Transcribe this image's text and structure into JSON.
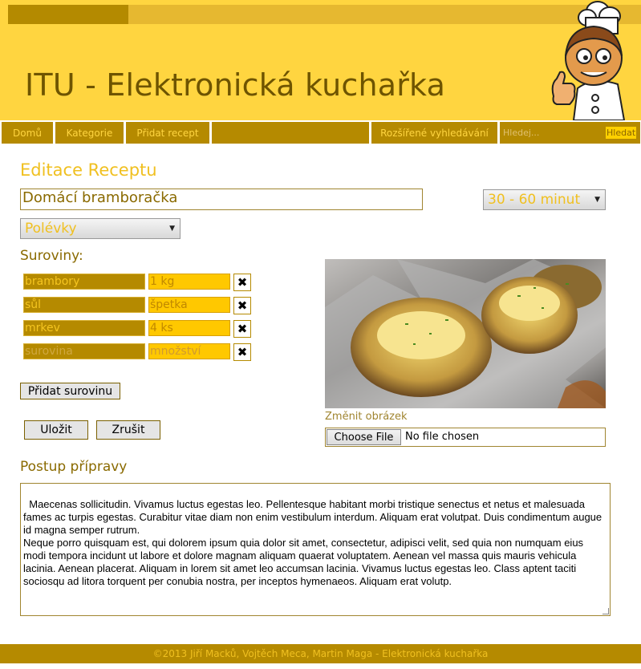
{
  "header": {
    "title": "ITU - Elektronická kuchařka",
    "mascot_icon": "chef-mascot-icon"
  },
  "nav": {
    "items": [
      {
        "label": "Domů"
      },
      {
        "label": "Kategorie"
      },
      {
        "label": "Přidat recept"
      },
      {
        "label": ""
      },
      {
        "label": "Rozšířené vyhledávání"
      }
    ],
    "search_placeholder": "Hledej...",
    "search_button": "Hledat"
  },
  "main": {
    "page_heading": "Editace Receptu",
    "recipe_name": "Domácí bramboračka",
    "time_select": "30 - 60 minut",
    "category_select": "Polévky",
    "ingredients_heading": "Suroviny:",
    "ingredients": [
      {
        "name": "brambory",
        "qty": "1 kg"
      },
      {
        "name": "sůl",
        "qty": "špetka"
      },
      {
        "name": "mrkev",
        "qty": "4 ks"
      },
      {
        "name": "surovina",
        "qty": "množství",
        "placeholder": true
      }
    ],
    "delete_icon": "close-icon",
    "add_ingredient_button": "Přidat surovinu",
    "save_button": "Uložit",
    "cancel_button": "Zrušit",
    "change_image_label": "Změnit obrázek",
    "file_button": "Choose File",
    "file_status": "No file chosen",
    "procedure_heading": "Postup přípravy",
    "procedure_text": "Maecenas sollicitudin. Vivamus luctus egestas leo. Pellentesque habitant morbi tristique senectus et netus et malesuada fames ac turpis egestas. Curabitur vitae diam non enim vestibulum interdum. Aliquam erat volutpat. Duis condimentum augue id magna semper rutrum.\nNeque porro quisquam est, qui dolorem ipsum quia dolor sit amet, consectetur, adipisci velit, sed quia non numquam eius modi tempora incidunt ut labore et dolore magnam aliquam quaerat voluptatem. Aenean vel massa quis mauris vehicula lacinia. Aenean placerat. Aliquam in lorem sit amet leo accumsan lacinia. Vivamus luctus egestas leo. Class aptent taciti sociosqu ad litora torquent per conubia nostra, per inceptos hymenaeos. Aliquam erat volutp."
  },
  "footer": {
    "text": "©2013 Jiří Macků, Vojtěch Meca, Martin Maga - Elektronická kuchařka"
  },
  "colors": {
    "header_bg": "#ffd540",
    "nav_bg": "#b58a00",
    "accent": "#f0c020",
    "dark_text": "#6e5400"
  }
}
